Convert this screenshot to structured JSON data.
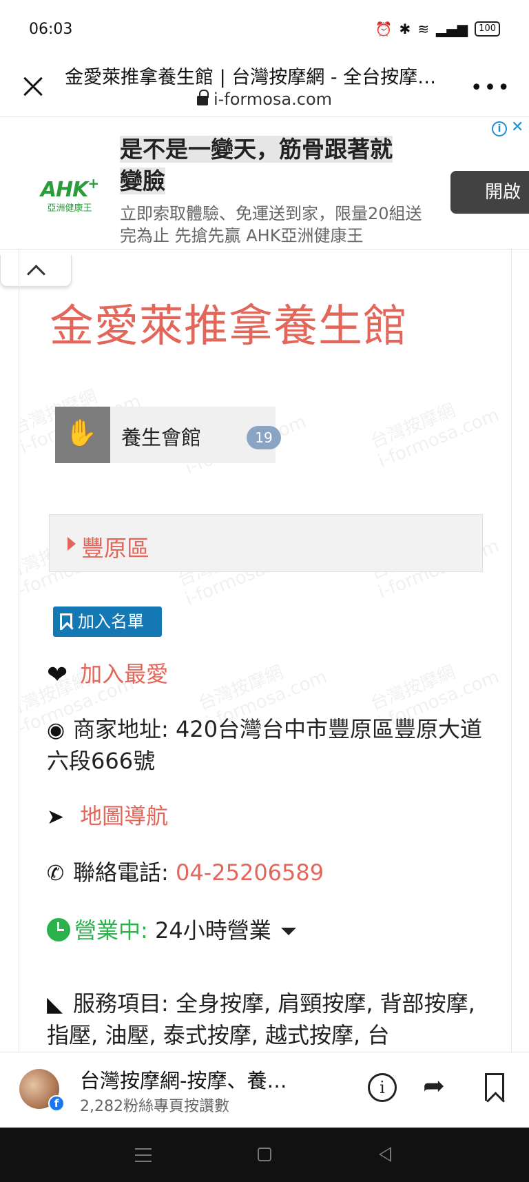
{
  "status_bar": {
    "time": "06:03",
    "battery": "100"
  },
  "browser": {
    "title": "金愛萊推拿養生館 | 台灣按摩網 - 全台按摩…",
    "url": "i-formosa.com",
    "more": "•••"
  },
  "ad": {
    "brand_mark": "AHK",
    "brand_name": "亞洲健康王",
    "headline_line1": "是不是一變天，筋骨跟著就",
    "headline_line2": "變臉",
    "description": "立即索取體驗、免運送到家，限量20組送完為止 先搶先贏 AHK亞洲健康王",
    "open_button": "開啟",
    "info_icon": "i",
    "close_icon": "✕"
  },
  "page": {
    "store_title": "金愛萊推拿養生館",
    "category": {
      "label": "養生會館",
      "count": "19"
    },
    "district": "豐原區",
    "add_to_list": "加入名單",
    "add_favorite": "加入最愛",
    "address_label": "商家地址:",
    "address_value": "420台灣台中市豐原區豐原大道六段666號",
    "navigate": "地圖導航",
    "phone_label": "聯絡電話:",
    "phone_value": "04-25206589",
    "hours_status": "營業中:",
    "hours_value": "24小時營業",
    "services_label": "服務項目:",
    "services_value": "全身按摩, 肩頸按摩, 背部按摩, 指壓, 油壓, 泰式按摩, 越式按摩, 台"
  },
  "watermark": {
    "cn": "台灣按摩網",
    "en": "i-formosa.com"
  },
  "fb_bar": {
    "page_name": "台灣按摩網-按摩、養…",
    "likes": "2,282粉絲專頁按讚數"
  },
  "colors": {
    "accent": "#e3665a",
    "blue_button": "#1478b4",
    "open_green": "#2bb24c"
  }
}
